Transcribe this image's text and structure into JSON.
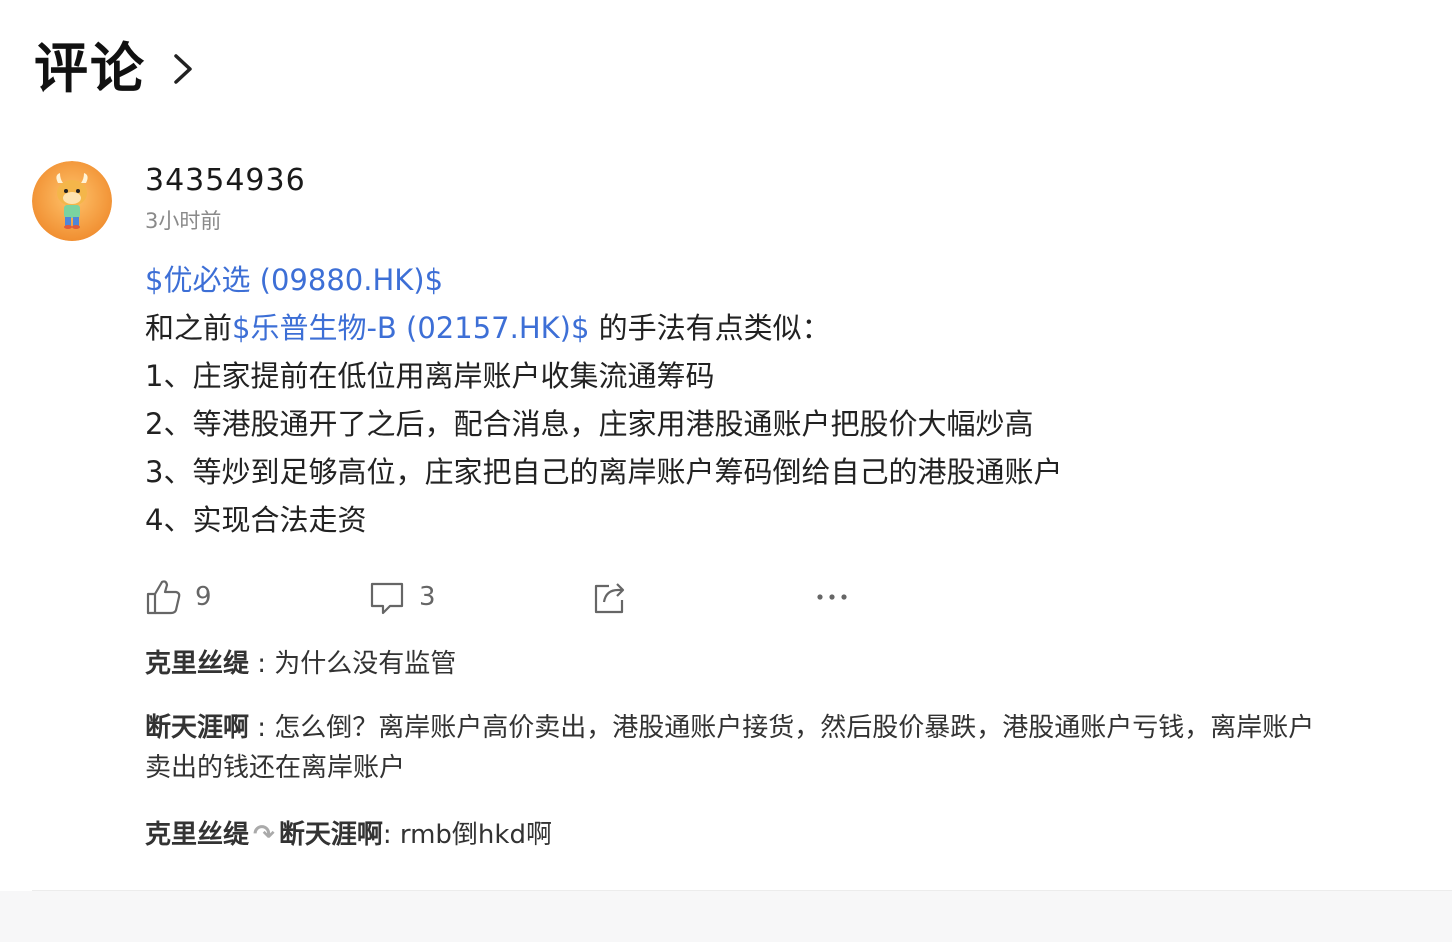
{
  "header": {
    "title": "评论"
  },
  "comment": {
    "username": "34354936",
    "time": "3小时前",
    "line1_stock": "$优必选 (09880.HK)$",
    "line2_prefix": "和之前",
    "line2_stock": "$乐普生物-B (02157.HK)$",
    "line2_suffix": " 的手法有点类似：",
    "points": [
      "1、庄家提前在低位用离岸账户收集流通筹码",
      "2、等港股通开了之后，配合消息，庄家用港股通账户把股价大幅炒高",
      "3、等炒到足够高位，庄家把自己的离岸账户筹码倒给自己的港股通账户",
      "4、实现合法走资"
    ],
    "likes": "9",
    "comments_count": "3"
  },
  "replies": [
    {
      "nick": "克里丝缇",
      "text": " : 为什么没有监管"
    },
    {
      "nick": "断天涯啊",
      "text": " : 怎么倒？离岸账户高价卖出，港股通账户接货，然后股价暴跌，港股通账户亏钱，离岸账户卖出的钱还在离岸账户"
    },
    {
      "nick": "克里丝缇",
      "to": "断天涯啊",
      "text": ": rmb倒hkd啊"
    }
  ],
  "icons": {
    "header_arrow": "chevron-right-icon",
    "like": "thumbs-up-icon",
    "comment": "comment-bubble-icon",
    "share": "share-icon",
    "more": "more-dots-icon",
    "reply_arrow": "reply-arrow-icon"
  },
  "colors": {
    "link": "#3d6fd6",
    "avatar_bg": "#f0a046"
  }
}
